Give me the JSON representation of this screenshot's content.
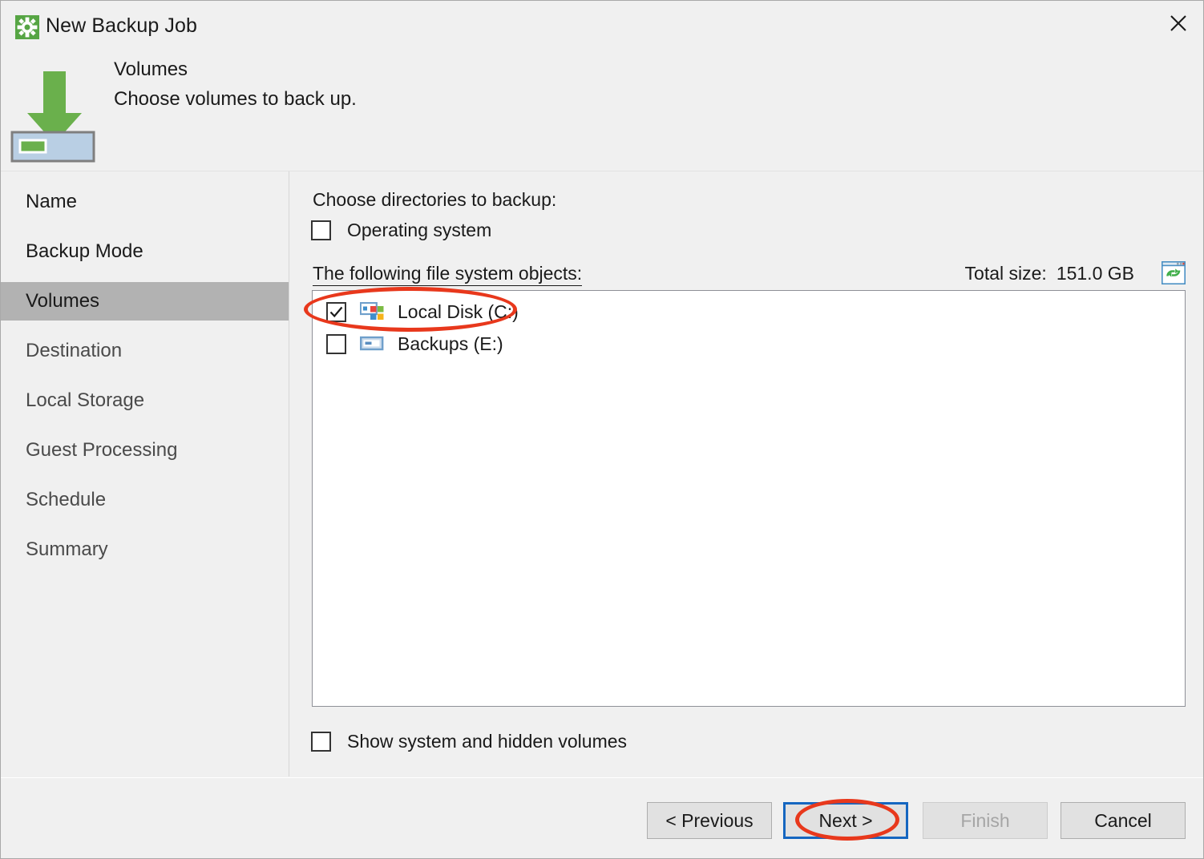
{
  "window": {
    "title": "New Backup Job",
    "title_icon": "gear-icon",
    "close_icon": "close-icon"
  },
  "header": {
    "step_title": "Volumes",
    "description": "Choose volumes to back up.",
    "icon": "volume-backup-arrow-icon"
  },
  "sidebar": {
    "items": [
      {
        "label": "Name",
        "state": "done"
      },
      {
        "label": "Backup Mode",
        "state": "done"
      },
      {
        "label": "Volumes",
        "state": "active"
      },
      {
        "label": "Destination",
        "state": "pending"
      },
      {
        "label": "Local Storage",
        "state": "pending"
      },
      {
        "label": "Guest Processing",
        "state": "pending"
      },
      {
        "label": "Schedule",
        "state": "pending"
      },
      {
        "label": "Summary",
        "state": "pending"
      }
    ]
  },
  "main": {
    "choose_label": "Choose directories to backup:",
    "os_checkbox": {
      "label": "Operating system",
      "checked": false
    },
    "following_label": "The following file system objects:",
    "total_size_label": "Total size:",
    "total_size_value": "151.0 GB",
    "refresh_icon": "refresh-icon",
    "volumes": [
      {
        "label": "Local Disk (C:)",
        "checked": true,
        "icon": "windows-drive-icon"
      },
      {
        "label": "Backups (E:)",
        "checked": false,
        "icon": "drive-icon"
      }
    ],
    "show_hidden_checkbox": {
      "label": "Show system and hidden volumes",
      "checked": false
    }
  },
  "footer": {
    "previous": "< Previous",
    "next": "Next >",
    "finish": "Finish",
    "cancel": "Cancel"
  },
  "annotations": [
    {
      "name": "local-disk-highlight",
      "color": "#e8381c"
    },
    {
      "name": "next-button-highlight",
      "color": "#e8381c"
    }
  ],
  "colors": {
    "accent_green": "#6ab04c",
    "focus_blue": "#1566c0",
    "annotation_red": "#e8381c",
    "active_row": "#b2b2b2"
  }
}
